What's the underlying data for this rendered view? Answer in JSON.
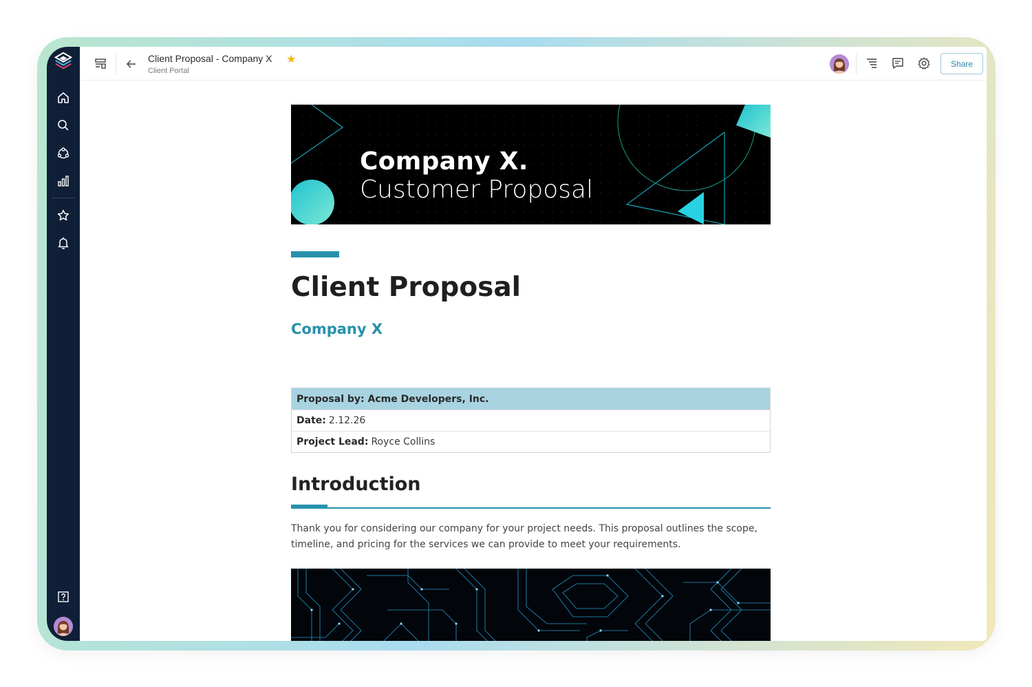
{
  "header": {
    "title": "Client Proposal - Company X",
    "subtitle": "Client Portal",
    "share_label": "Share"
  },
  "sidebar": {
    "items": [
      {
        "name": "home-icon"
      },
      {
        "name": "search-icon"
      },
      {
        "name": "spaces-icon"
      },
      {
        "name": "analytics-icon"
      },
      {
        "name": "star-icon"
      },
      {
        "name": "bell-icon"
      },
      {
        "name": "help-icon"
      }
    ]
  },
  "banner": {
    "line1": "Company X.",
    "line2": "Customer Proposal"
  },
  "doc": {
    "title": "Client Proposal",
    "company": "Company X",
    "table": {
      "proposal_label": "Proposal by: Acme Developers, Inc.",
      "date_label": "Date:",
      "date_value": "2.12.26",
      "lead_label": "Project Lead:",
      "lead_value": "Royce Collins"
    },
    "intro_heading": "Introduction",
    "intro_text": "Thank you for considering our company for your project needs. This proposal outlines the scope, timeline, and pricing for the services we can provide to meet your requirements."
  },
  "colors": {
    "sidebar": "#0f1f37",
    "accent": "#2791ab",
    "table_header": "#a8d3e1",
    "star": "#f5b301"
  }
}
